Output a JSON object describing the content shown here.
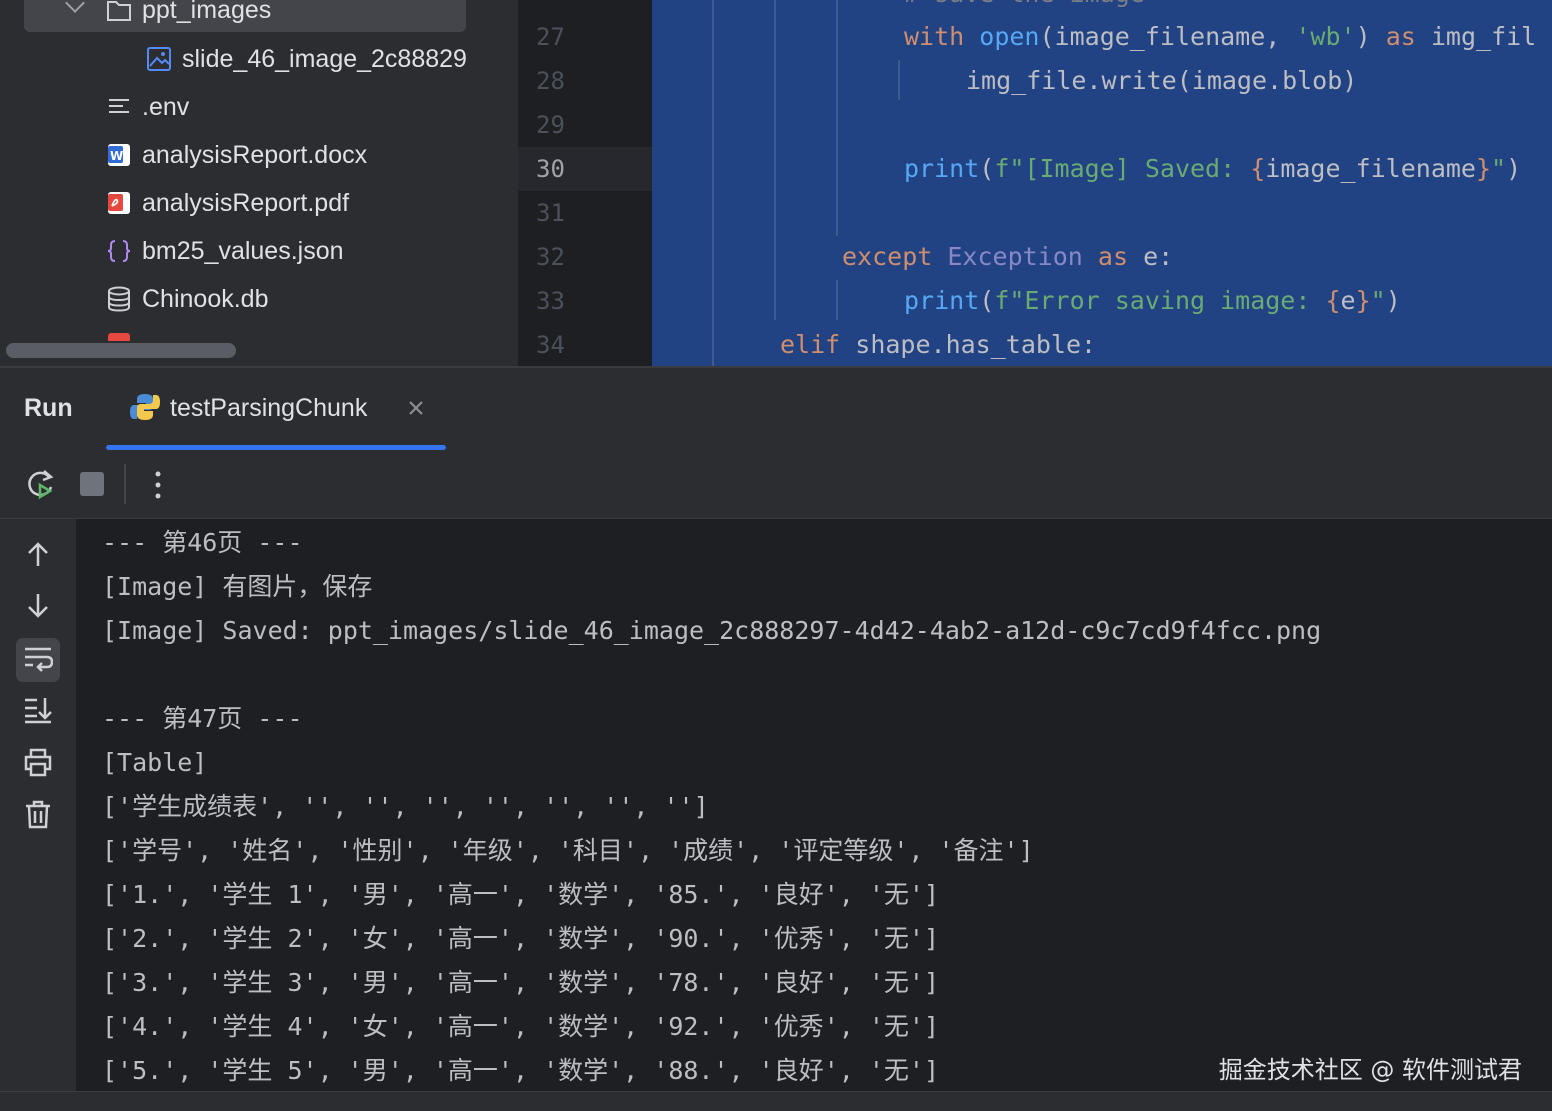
{
  "project": {
    "items": [
      {
        "label": "ppt_images",
        "icon": "folder-icon"
      },
      {
        "label": "slide_46_image_2c88829",
        "icon": "image-file-icon"
      },
      {
        "label": ".env",
        "icon": "text-file-icon"
      },
      {
        "label": "analysisReport.docx",
        "icon": "word-file-icon"
      },
      {
        "label": "analysisReport.pdf",
        "icon": "pdf-file-icon"
      },
      {
        "label": "bm25_values.json",
        "icon": "json-file-icon"
      },
      {
        "label": "Chinook.db",
        "icon": "database-icon"
      }
    ]
  },
  "gutter": {
    "lines": [
      "27",
      "28",
      "29",
      "30",
      "31",
      "32",
      "33",
      "34"
    ],
    "current": "30"
  },
  "editor": {
    "lines": [
      {
        "tokens": [
          {
            "t": "with",
            "c": "kw"
          },
          {
            "t": " "
          },
          {
            "t": "open",
            "c": "fn"
          },
          {
            "t": "(image_filename, "
          },
          {
            "t": "'wb'",
            "c": "st"
          },
          {
            "t": ") "
          },
          {
            "t": "as",
            "c": "kw"
          },
          {
            "t": " img_fil"
          }
        ]
      },
      {
        "tokens": [
          {
            "t": "img_file.write(image.blob)"
          }
        ]
      },
      {
        "tokens": []
      },
      {
        "tokens": [
          {
            "t": "print",
            "c": "fn"
          },
          {
            "t": "("
          },
          {
            "t": "f\"[Image] Saved: ",
            "c": "st"
          },
          {
            "t": "{",
            "c": "br"
          },
          {
            "t": "image_filename",
            "c": "df"
          },
          {
            "t": "}",
            "c": "br"
          },
          {
            "t": "\"",
            "c": "st"
          },
          {
            "t": ")"
          }
        ]
      },
      {
        "tokens": []
      },
      {
        "tokens": [
          {
            "t": "except",
            "c": "kw"
          },
          {
            "t": " "
          },
          {
            "t": "Exception",
            "c": "bl"
          },
          {
            "t": " "
          },
          {
            "t": "as",
            "c": "kw"
          },
          {
            "t": " e:"
          }
        ]
      },
      {
        "tokens": [
          {
            "t": "print",
            "c": "fn"
          },
          {
            "t": "("
          },
          {
            "t": "f\"Error saving image: ",
            "c": "st"
          },
          {
            "t": "{",
            "c": "br"
          },
          {
            "t": "e",
            "c": "df"
          },
          {
            "t": "}",
            "c": "br"
          },
          {
            "t": "\"",
            "c": "st"
          },
          {
            "t": ")"
          }
        ]
      },
      {
        "tokens": [
          {
            "t": "elif",
            "c": "kw"
          },
          {
            "t": " shape.has_table:"
          }
        ]
      }
    ]
  },
  "run_panel": {
    "title": "Run",
    "tab_label": "testParsingChunk"
  },
  "console": {
    "lines": [
      "--- 第46页 ---",
      "[Image] 有图片，保存",
      "[Image] Saved: ppt_images/slide_46_image_2c888297-4d42-4ab2-a12d-c9c7cd9f4fcc.png",
      "",
      "--- 第47页 ---",
      "[Table]",
      "['学生成绩表', '', '', '', '', '', '', '']",
      "['学号', '姓名', '性别', '年级', '科目', '成绩', '评定等级', '备注']",
      "['1.', '学生 1', '男', '高一', '数学', '85.', '良好', '无']",
      "['2.', '学生 2', '女', '高一', '数学', '90.', '优秀', '无']",
      "['3.', '学生 3', '男', '高一', '数学', '78.', '良好', '无']",
      "['4.', '学生 4', '女', '高一', '数学', '92.', '优秀', '无']",
      "['5.', '学生 5', '男', '高一', '数学', '88.', '良好', '无']"
    ]
  },
  "watermark": "掘金技术社区 @ 软件测试君",
  "colors": {
    "accent": "#3574f0",
    "editor_selection": "#214283"
  }
}
